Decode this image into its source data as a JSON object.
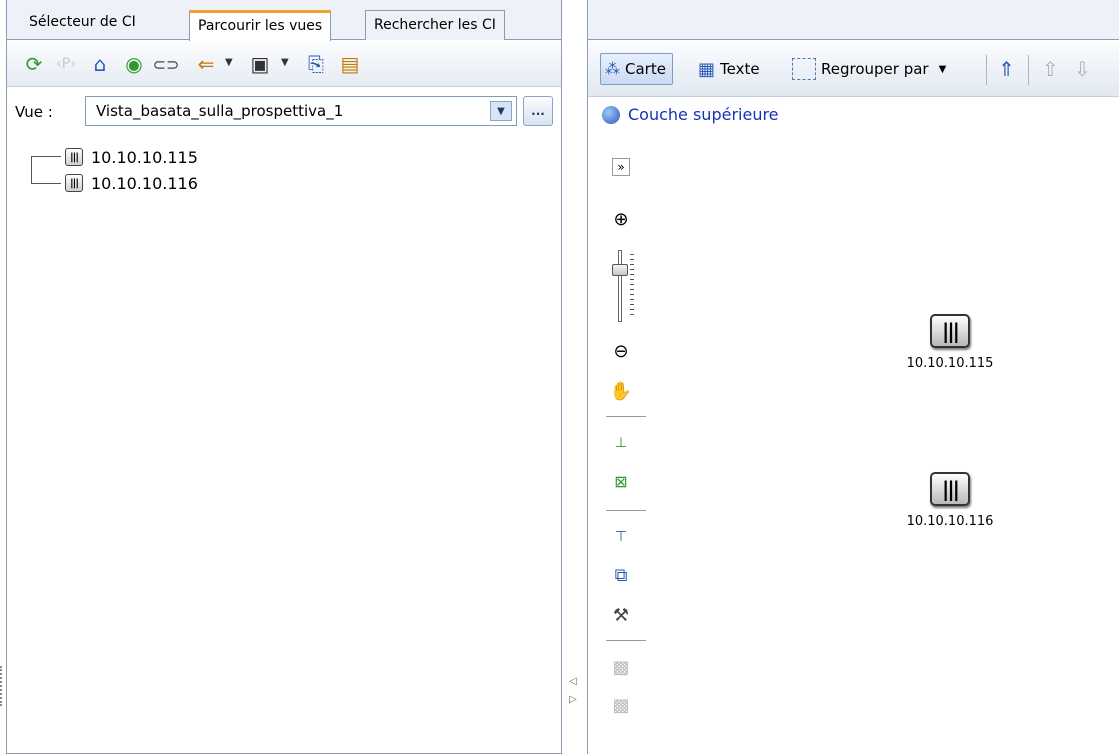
{
  "left": {
    "tabs": [
      {
        "label": "Sélecteur de CI",
        "active": false
      },
      {
        "label": "Parcourir les vues",
        "active": true
      },
      {
        "label": "Rechercher les CI",
        "active": false
      }
    ],
    "toolbar_icons": [
      "refresh-icon",
      "show-properties-icon",
      "presentation-icon",
      "discovery-icon",
      "link-icon",
      "import-icon",
      "save-icon",
      "export-icon",
      "report-icon"
    ],
    "view_label": "Vue :",
    "view_selected": "Vista_basata_sulla_prospettiva_1",
    "ellipsis": "...",
    "tree": [
      {
        "label": "10.10.10.115"
      },
      {
        "label": "10.10.10.116"
      }
    ]
  },
  "right": {
    "toolbar": {
      "map_label": "Carte",
      "text_label": "Texte",
      "group_by_label": "Regrouper par"
    },
    "breadcrumb": "Couche supérieure",
    "nodes": [
      {
        "label": "10.10.10.115"
      },
      {
        "label": "10.10.10.116"
      }
    ]
  },
  "colors": {
    "accent_tab": "#f0a230",
    "link": "#1533b8",
    "border": "#8a9bb3"
  }
}
